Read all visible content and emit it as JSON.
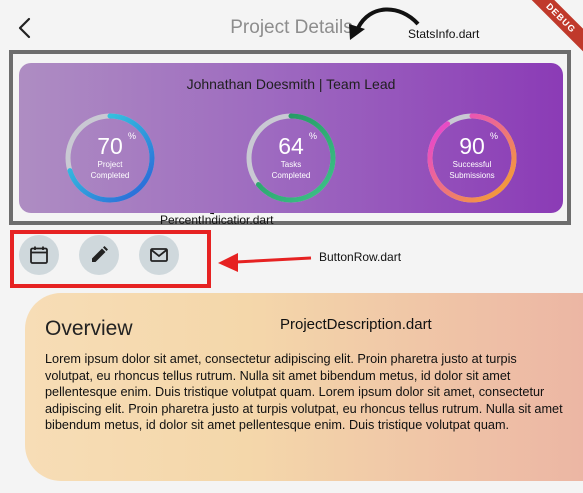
{
  "app_bar": {
    "title": "Project Details",
    "debug_banner": "DEBUG",
    "back_icon": "chevron-left-icon"
  },
  "annotations": {
    "stats_info": "StatsInfo.dart",
    "percent_indicator": "PercentIndicatior.dart",
    "button_row": "ButtonRow.dart",
    "project_description": "ProjectDescription.dart"
  },
  "stats": {
    "heading": "Johnathan Doesmith | Team Lead",
    "gauges": [
      {
        "value": "70",
        "unit": "%",
        "label_line1": "Project",
        "label_line2": "Completed",
        "percent": 70
      },
      {
        "value": "64",
        "unit": "%",
        "label_line1": "Tasks",
        "label_line2": "Completed",
        "percent": 64
      },
      {
        "value": "90",
        "unit": "%",
        "label_line1": "Successful",
        "label_line2": "Submissions",
        "percent": 90
      }
    ]
  },
  "buttons": [
    {
      "icon": "calendar-icon"
    },
    {
      "icon": "pencil-icon"
    },
    {
      "icon": "mail-icon"
    }
  ],
  "description": {
    "heading": "Overview",
    "body": "Lorem ipsum dolor sit amet, consectetur adipiscing elit. Proin pharetra justo at turpis volutpat, eu rhoncus tellus rutrum. Nulla sit amet bibendum metus, id dolor sit amet pellentesque enim. Duis tristique volutpat quam. Lorem ipsum dolor sit amet, consectetur adipiscing elit. Proin pharetra justo at turpis volutpat, eu rhoncus tellus rutrum. Nulla sit amet bibendum metus, id dolor sit amet pellentesque enim. Duis tristique volutpat quam."
  },
  "colors": {
    "gauge_track": "#c9c9d3",
    "gauge1_start": "#2b5fd9",
    "gauge1_end": "#38e0e0",
    "gauge2_start": "#1e8f5b",
    "gauge2_end": "#3fc38a",
    "gauge3_start": "#f5a623",
    "gauge3_end": "#e63ce0",
    "annotation_black": "#111111",
    "annotation_red": "#e62222"
  }
}
